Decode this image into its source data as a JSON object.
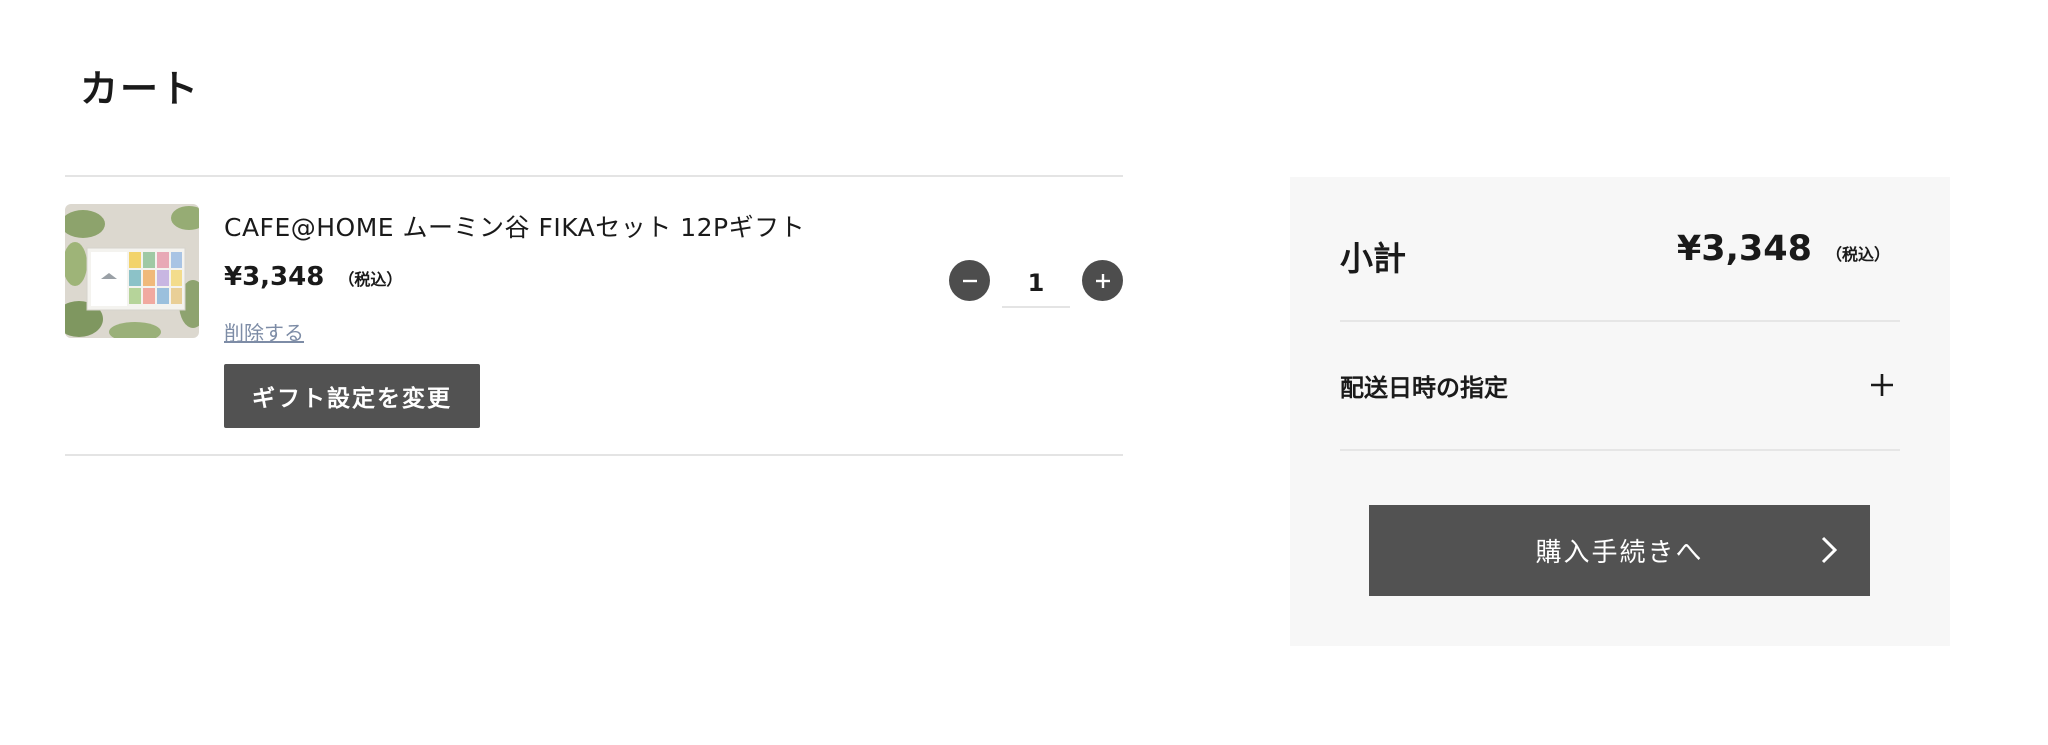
{
  "page": {
    "title": "カート"
  },
  "cart": {
    "items": [
      {
        "name": "CAFE@HOME ムーミン谷 FIKAセット 12Pギフト",
        "price": "¥3,348",
        "tax_note": "（税込）",
        "delete_label": "削除する",
        "gift_button_label": "ギフト設定を変更",
        "quantity": "1",
        "image_icon": "product-thumbnail-image"
      }
    ]
  },
  "summary": {
    "subtotal_label": "小計",
    "subtotal_price": "¥3,348",
    "subtotal_tax_note": "（税込）",
    "delivery_label": "配送日時の指定",
    "checkout_label": "購入手続きへ"
  },
  "colors": {
    "button_dark": "#525252",
    "qty_button": "#4d4d4d",
    "link": "#7d8ca6",
    "panel_bg": "#f7f7f7",
    "divider": "#e4e4e4"
  }
}
